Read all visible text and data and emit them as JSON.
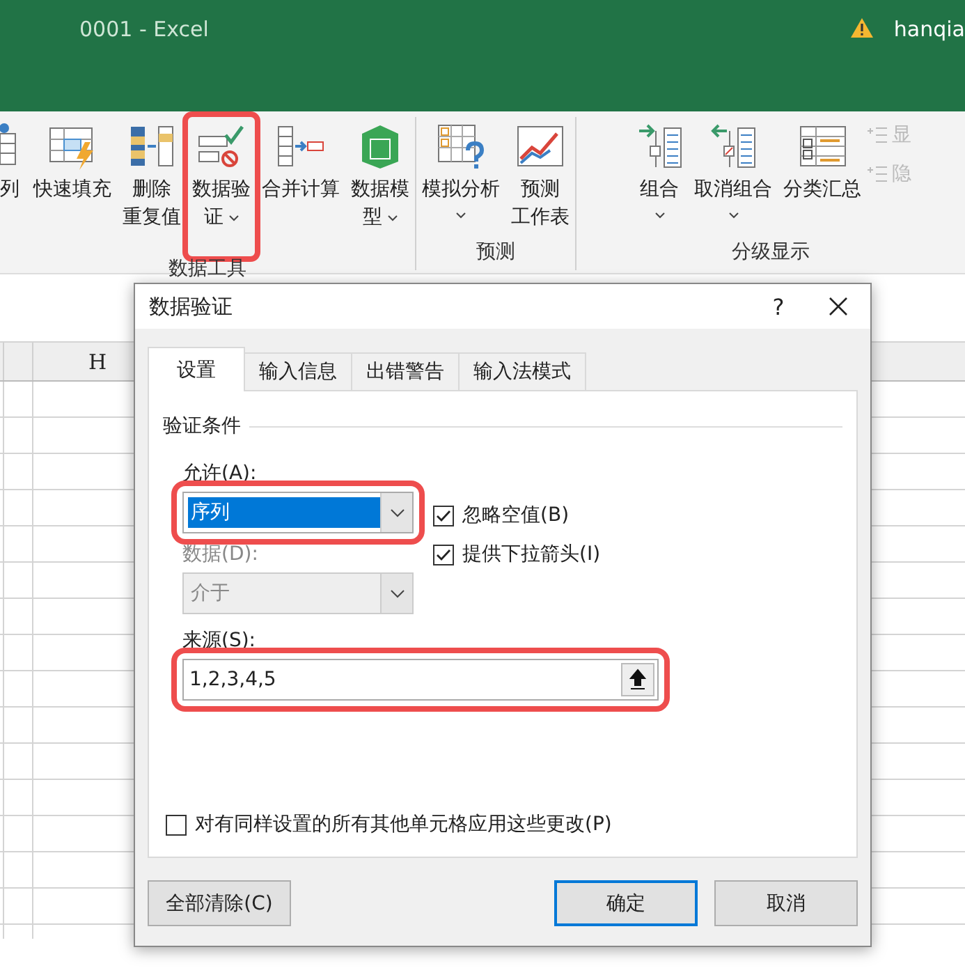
{
  "title_bar": {
    "title": "0001  -  Excel",
    "user": "hanqia"
  },
  "ribbon": {
    "groups": [
      {
        "label": "数据工具",
        "items": [
          {
            "lines": [
              "列"
            ],
            "dropdown": false,
            "highlighted": false
          },
          {
            "lines": [
              "快速填充"
            ],
            "dropdown": false,
            "highlighted": false
          },
          {
            "lines": [
              "删除",
              "重复值"
            ],
            "dropdown": false,
            "highlighted": false
          },
          {
            "lines": [
              "数据验",
              "证"
            ],
            "dropdown": true,
            "highlighted": true
          },
          {
            "lines": [
              "合并计算"
            ],
            "dropdown": false,
            "highlighted": false
          },
          {
            "lines": [
              "数据模",
              "型"
            ],
            "dropdown": true,
            "highlighted": false
          }
        ]
      },
      {
        "label": "预测",
        "items": [
          {
            "lines": [
              "模拟分析"
            ],
            "dropdown": true,
            "highlighted": false
          },
          {
            "lines": [
              "预测",
              "工作表"
            ],
            "dropdown": false,
            "highlighted": false
          }
        ]
      },
      {
        "label": "分级显示",
        "items": [
          {
            "lines": [
              "组合"
            ],
            "dropdown": true,
            "highlighted": false
          },
          {
            "lines": [
              "取消组合"
            ],
            "dropdown": true,
            "highlighted": false
          },
          {
            "lines": [
              "分类汇总"
            ],
            "dropdown": false,
            "highlighted": false
          }
        ],
        "small_items": [
          {
            "label": "显",
            "disabled": true
          },
          {
            "label": "隐",
            "disabled": true
          }
        ]
      }
    ]
  },
  "sheet": {
    "columns": [
      "H"
    ]
  },
  "dialog": {
    "title": "数据验证",
    "help": "?",
    "tabs": [
      {
        "label": "设置",
        "selected": true
      },
      {
        "label": "输入信息",
        "selected": false
      },
      {
        "label": "出错警告",
        "selected": false
      },
      {
        "label": "输入法模式",
        "selected": false
      }
    ],
    "section": "验证条件",
    "allow": {
      "label": "允许(A):",
      "value": "序列",
      "disabled": false,
      "highlighted": true
    },
    "data": {
      "label": "数据(D):",
      "value": "介于",
      "disabled": true
    },
    "options": [
      {
        "label": "忽略空值(B)",
        "checked": true
      },
      {
        "label": "提供下拉箭头(I)",
        "checked": true
      }
    ],
    "source": {
      "label": "来源(S):",
      "value": "1,2,3,4,5",
      "highlighted": true
    },
    "apply_all": {
      "label": "对有同样设置的所有其他单元格应用这些更改(P)",
      "checked": false
    },
    "buttons": [
      {
        "label": "全部清除(C)",
        "default": false
      },
      {
        "label": "确定",
        "default": true
      },
      {
        "label": "取消",
        "default": false
      }
    ]
  }
}
